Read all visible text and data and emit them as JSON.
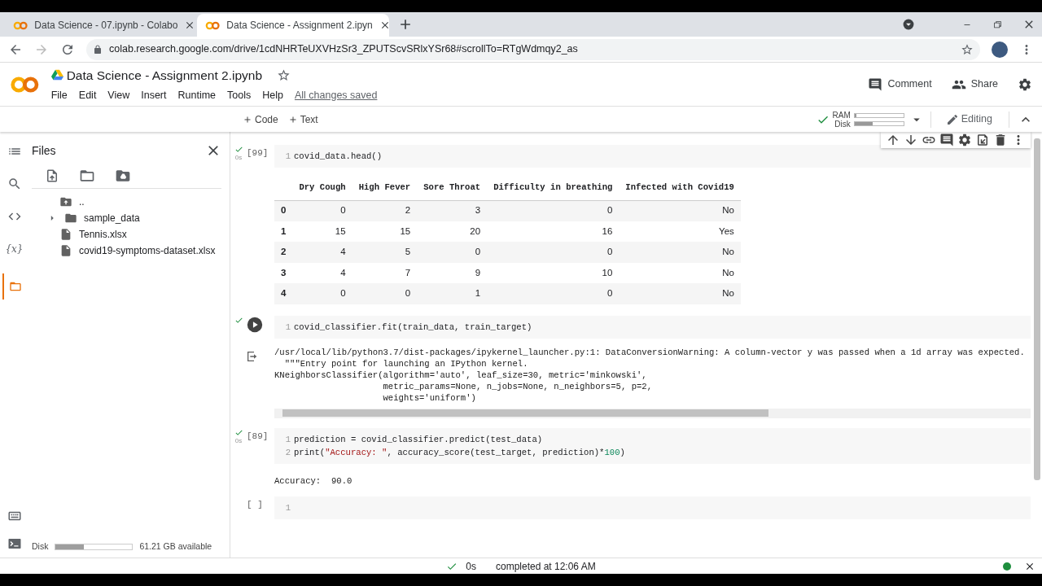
{
  "browser": {
    "tabs": [
      {
        "title": "Data Science - 07.ipynb - Colabo",
        "selected": false
      },
      {
        "title": "Data Science - Assignment 2.ipyn",
        "selected": true
      }
    ],
    "url": "colab.research.google.com/drive/1cdNHRTeUXVHzSr3_ZPUTScvSRlxYSr68#scrollTo=RTgWdmqy2_as"
  },
  "notebook": {
    "title": "Data Science - Assignment 2.ipynb",
    "starred": false,
    "menu": [
      "File",
      "Edit",
      "View",
      "Insert",
      "Runtime",
      "Tools",
      "Help"
    ],
    "save_status": "All changes saved",
    "actions": [
      "Comment",
      "Share"
    ]
  },
  "toolbar": {
    "insert": [
      "Code",
      "Text"
    ],
    "connected": true,
    "ram": {
      "label": "RAM",
      "level": 0.04
    },
    "disk": {
      "label": "Disk",
      "level": 0.37
    },
    "mode": "Editing"
  },
  "sidebar": {
    "rail": [
      {
        "kind": "toc",
        "selected": false
      },
      {
        "kind": "search",
        "selected": false
      },
      {
        "kind": "snippets",
        "selected": false
      },
      {
        "kind": "variables",
        "label": "{x}",
        "selected": false
      },
      {
        "kind": "files",
        "selected": true
      }
    ],
    "title": "Files",
    "tree": [
      {
        "name": "..",
        "kind": "parent"
      },
      {
        "name": "sample_data",
        "kind": "folder",
        "expanded": false
      },
      {
        "name": "Tennis.xlsx",
        "kind": "file"
      },
      {
        "name": "covid19-symptoms-dataset.xlsx",
        "kind": "file"
      }
    ],
    "disk": {
      "label": "Disk",
      "level": 0.37,
      "available": "61.21 GB available"
    }
  },
  "cells": [
    {
      "executed": true,
      "duration": "0s",
      "hovered": false,
      "count": "[99]",
      "lines": [
        {
          "number": "1",
          "tokens": [
            {
              "text": "covid_data.head()",
              "kind": "plain"
            }
          ]
        }
      ],
      "output": {
        "kind": "table",
        "columns": [
          "Dry Cough",
          "High Fever",
          "Sore Throat",
          "Difficulty in breathing",
          "Infected with Covid19"
        ],
        "rows": [
          {
            "index": "0",
            "values": [
              "0",
              "2",
              "3",
              "0",
              "No"
            ]
          },
          {
            "index": "1",
            "values": [
              "15",
              "15",
              "20",
              "16",
              "Yes"
            ]
          },
          {
            "index": "2",
            "values": [
              "4",
              "5",
              "0",
              "0",
              "No"
            ]
          },
          {
            "index": "3",
            "values": [
              "4",
              "7",
              "9",
              "10",
              "No"
            ]
          },
          {
            "index": "4",
            "values": [
              "0",
              "0",
              "1",
              "0",
              "No"
            ]
          }
        ]
      }
    },
    {
      "executed": true,
      "hovered": true,
      "lines": [
        {
          "number": "1",
          "tokens": [
            {
              "text": "covid_classifier.fit(train_data, train_target)",
              "kind": "plain"
            }
          ]
        }
      ],
      "output": {
        "kind": "stream",
        "lines": [
          "/usr/local/lib/python3.7/dist-packages/ipykernel_launcher.py:1: DataConversionWarning: A column-vector y was passed when a 1d array was expected.",
          "  \"\"\"Entry point for launching an IPython kernel.",
          "KNeighborsClassifier(algorithm='auto', leaf_size=30, metric='minkowski',",
          "                     metric_params=None, n_jobs=None, n_neighbors=5, p=2,",
          "                     weights='uniform')"
        ]
      }
    },
    {
      "executed": true,
      "duration": "0s",
      "hovered": false,
      "count": "[89]",
      "lines": [
        {
          "number": "1",
          "tokens": [
            {
              "text": "prediction = covid_classifier.predict(test_data)",
              "kind": "plain"
            }
          ]
        },
        {
          "number": "2",
          "tokens": [
            {
              "text": "print(",
              "kind": "plain"
            },
            {
              "text": "\"Accuracy: \"",
              "kind": "string"
            },
            {
              "text": ", accuracy_score(test_target, prediction)*",
              "kind": "plain"
            },
            {
              "text": "100",
              "kind": "number"
            },
            {
              "text": ")",
              "kind": "plain"
            }
          ]
        }
      ],
      "output": {
        "kind": "text",
        "lines": [
          "Accuracy:  90.0"
        ]
      }
    },
    {
      "executed": false,
      "hovered": false,
      "count": "[ ]",
      "lines": [
        {
          "number": "1"
        }
      ]
    }
  ],
  "status_bar": {
    "connected": true,
    "duration": "0s",
    "message": "completed at 12:06 AM"
  }
}
